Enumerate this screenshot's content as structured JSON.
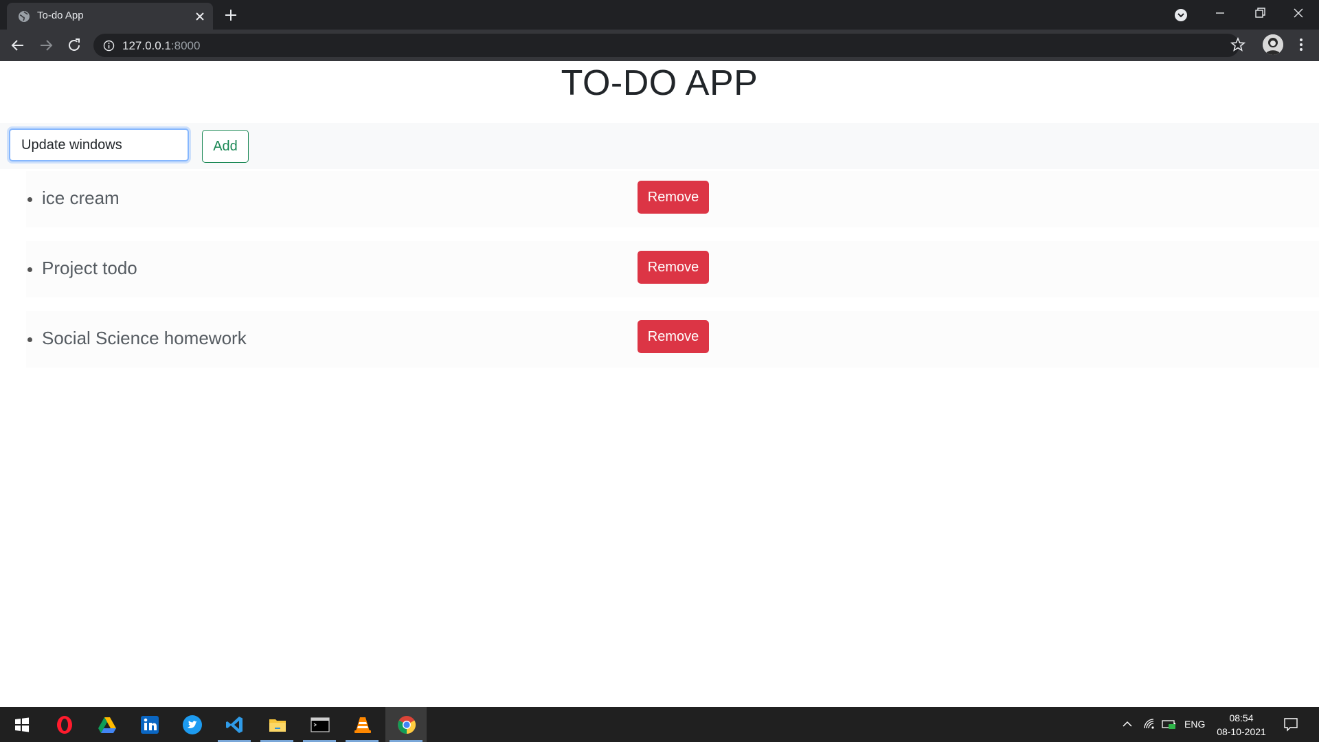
{
  "browser": {
    "tab_title": "To-do App",
    "url_host": "127.0.0.1",
    "url_port": ":8000"
  },
  "page": {
    "title": "TO-DO APP",
    "input_value": "Update windows",
    "add_label": "Add",
    "todos": [
      {
        "text": "ice cream",
        "remove_label": "Remove"
      },
      {
        "text": "Project todo",
        "remove_label": "Remove"
      },
      {
        "text": "Social Science homework",
        "remove_label": "Remove"
      }
    ]
  },
  "taskbar": {
    "apps": [
      "windows-start",
      "opera",
      "google-drive",
      "linkedin",
      "twitter",
      "vscode",
      "file-explorer",
      "terminal",
      "vlc",
      "chrome"
    ],
    "language": "ENG",
    "time": "08:54",
    "date": "08-10-2021"
  },
  "colors": {
    "danger": "#dc3545",
    "success": "#198754",
    "chrome_dark": "#202124"
  }
}
